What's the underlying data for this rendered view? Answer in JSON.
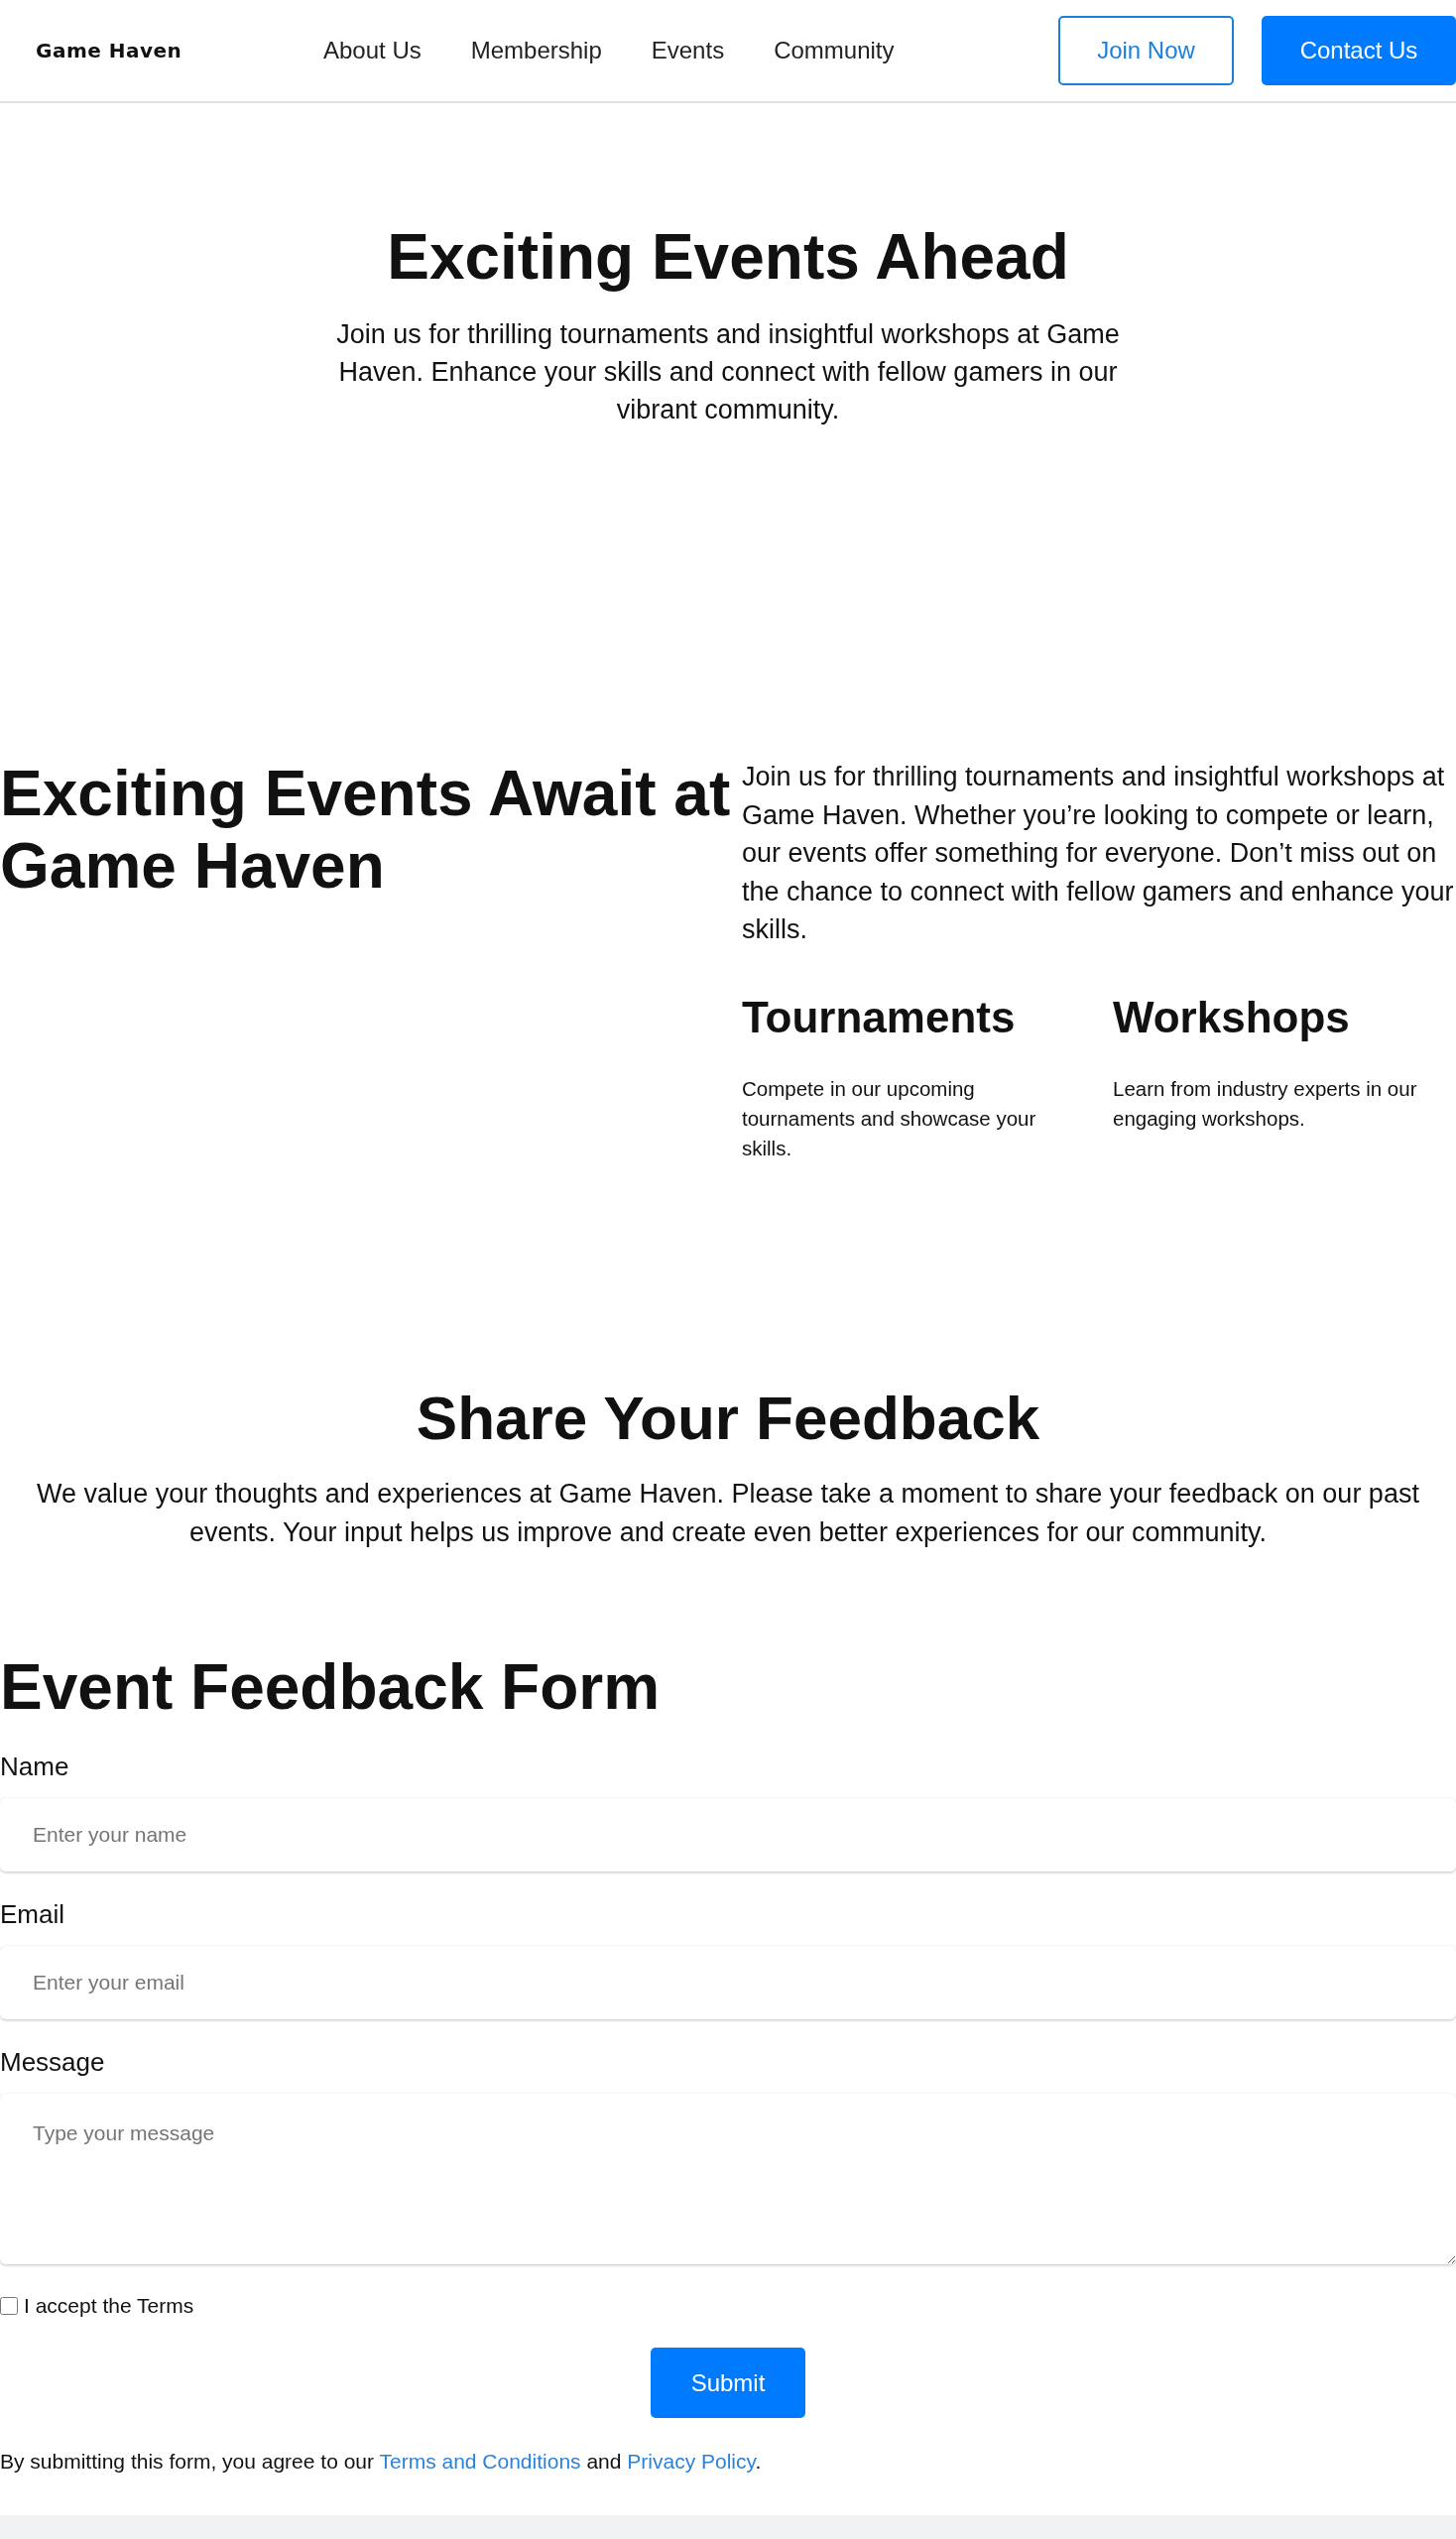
{
  "header": {
    "logo": "Game Haven",
    "nav": [
      {
        "label": "About Us"
      },
      {
        "label": "Membership"
      },
      {
        "label": "Events"
      },
      {
        "label": "Community"
      }
    ],
    "buttons": [
      {
        "label": "Join Now",
        "kind": "outline"
      },
      {
        "label": "Contact Us",
        "kind": "solid"
      }
    ]
  },
  "hero": {
    "title": "Exciting Events Ahead",
    "text": "Join us for thrilling tournaments and insightful workshops at Game Haven. Enhance your skills and connect with fellow gamers in our vibrant community."
  },
  "events": {
    "title": "Exciting Events Await at Game Haven",
    "text": "Join us for thrilling tournaments and insightful workshops at Game Haven. Whether you’re looking to compete or learn, our events offer something for everyone. Don’t miss out on the chance to connect with fellow gamers and enhance your skills.",
    "features": [
      {
        "title": "Tournaments",
        "text": "Compete in our upcoming tournaments and showcase your skills."
      },
      {
        "title": "Workshops",
        "text": "Learn from industry experts in our engaging workshops."
      }
    ]
  },
  "feedback": {
    "title": "Share Your Feedback",
    "text": "We value your thoughts and experiences at Game Haven. Please take a moment to share your feedback on our past events. Your input helps us improve and create even better experiences for our community."
  },
  "form": {
    "title": "Event Feedback Form",
    "fields": [
      {
        "label": "Name",
        "placeholder": "Enter your name",
        "kind": "input"
      },
      {
        "label": "Email",
        "placeholder": "Enter your email",
        "kind": "input"
      },
      {
        "label": "Message",
        "placeholder": "Type your message",
        "kind": "textarea"
      }
    ],
    "checkbox": {
      "label": "I accept the Terms",
      "checked": false
    },
    "submit": "Submit",
    "legal": {
      "before": "By submitting this form, you agree to our",
      "link1": "Terms and Conditions",
      "middle": "and",
      "link2": "Privacy Policy",
      "after": "."
    }
  }
}
